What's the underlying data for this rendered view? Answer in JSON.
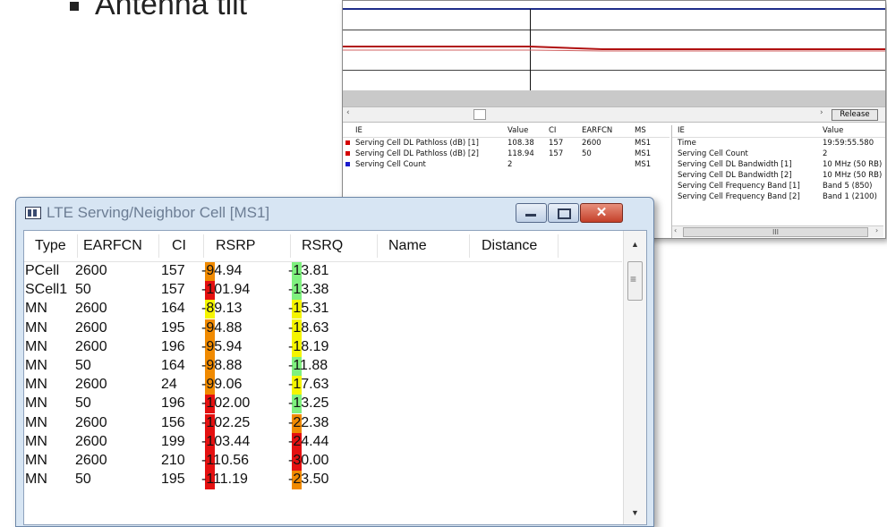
{
  "slide": {
    "bullet_text": "Antenna tilt"
  },
  "back_window": {
    "scroll_left": "‹",
    "scroll_right": "›",
    "release_label": "Release",
    "left_table": {
      "headers": [
        "IE",
        "Value",
        "CI",
        "EARFCN",
        "MS"
      ],
      "rows": [
        {
          "ie": "Serving Cell DL Pathloss (dB) [1]",
          "value": "108.38",
          "ci": "157",
          "earfcn": "2600",
          "ms": "MS1",
          "color": "#d40000"
        },
        {
          "ie": "Serving Cell DL Pathloss (dB) [2]",
          "value": "118.94",
          "ci": "157",
          "earfcn": "50",
          "ms": "MS1",
          "color": "#d40000"
        },
        {
          "ie": "Serving Cell Count",
          "value": "2",
          "ci": "",
          "earfcn": "",
          "ms": "MS1",
          "color": "#1a1acc"
        }
      ]
    },
    "right_table": {
      "headers": [
        "IE",
        "Value"
      ],
      "rows": [
        {
          "ie": "Time",
          "value": "19:59:55.580"
        },
        {
          "ie": "Serving Cell Count",
          "value": "2"
        },
        {
          "ie": "Serving Cell DL Bandwidth [1]",
          "value": "10 MHz (50 RB)"
        },
        {
          "ie": "Serving Cell DL Bandwidth [2]",
          "value": "10 MHz (50 RB)"
        },
        {
          "ie": "Serving Cell Frequency Band [1]",
          "value": "Band 5 (850)"
        },
        {
          "ie": "Serving Cell Frequency Band [2]",
          "value": "Band 1 (2100)"
        }
      ],
      "scroll_thumb_label": "III"
    }
  },
  "front_window": {
    "title": "LTE Serving/Neighbor Cell [MS1]",
    "columns": [
      "Type",
      "EARFCN",
      "CI",
      "RSRP",
      "RSRQ",
      "Name",
      "Distance"
    ],
    "rows": [
      {
        "type": "PCell",
        "earfcn": "2600",
        "ci": "157",
        "rsrp": "-94.94",
        "rsrq": "-13.81",
        "rsrp_color": "#f08a00",
        "rsrq_color": "#7ff07f"
      },
      {
        "type": "SCell1",
        "earfcn": "50",
        "ci": "157",
        "rsrp": "-101.94",
        "rsrq": "-13.38",
        "rsrp_color": "#e41010",
        "rsrq_color": "#7ff07f"
      },
      {
        "type": "MN",
        "earfcn": "2600",
        "ci": "164",
        "rsrp": "-89.13",
        "rsrq": "-15.31",
        "rsrp_color": "#f5f500",
        "rsrq_color": "#f5f500"
      },
      {
        "type": "MN",
        "earfcn": "2600",
        "ci": "195",
        "rsrp": "-94.88",
        "rsrq": "-18.63",
        "rsrp_color": "#f08a00",
        "rsrq_color": "#f5f500"
      },
      {
        "type": "MN",
        "earfcn": "2600",
        "ci": "196",
        "rsrp": "-95.94",
        "rsrq": "-18.19",
        "rsrp_color": "#f08a00",
        "rsrq_color": "#f5f500"
      },
      {
        "type": "MN",
        "earfcn": "50",
        "ci": "164",
        "rsrp": "-98.88",
        "rsrq": "-11.88",
        "rsrp_color": "#f08a00",
        "rsrq_color": "#7ff07f"
      },
      {
        "type": "MN",
        "earfcn": "2600",
        "ci": "24",
        "rsrp": "-99.06",
        "rsrq": "-17.63",
        "rsrp_color": "#f08a00",
        "rsrq_color": "#f5f500"
      },
      {
        "type": "MN",
        "earfcn": "50",
        "ci": "196",
        "rsrp": "-102.00",
        "rsrq": "-13.25",
        "rsrp_color": "#e41010",
        "rsrq_color": "#7ff07f"
      },
      {
        "type": "MN",
        "earfcn": "2600",
        "ci": "156",
        "rsrp": "-102.25",
        "rsrq": "-22.38",
        "rsrp_color": "#e41010",
        "rsrq_color": "#f08a00"
      },
      {
        "type": "MN",
        "earfcn": "2600",
        "ci": "199",
        "rsrp": "-103.44",
        "rsrq": "-24.44",
        "rsrp_color": "#e41010",
        "rsrq_color": "#e41010"
      },
      {
        "type": "MN",
        "earfcn": "2600",
        "ci": "210",
        "rsrp": "-110.56",
        "rsrq": "-30.00",
        "rsrp_color": "#e41010",
        "rsrq_color": "#e41010"
      },
      {
        "type": "MN",
        "earfcn": "50",
        "ci": "195",
        "rsrp": "-111.19",
        "rsrq": "-23.50",
        "rsrp_color": "#e41010",
        "rsrq_color": "#f08a00"
      }
    ]
  }
}
